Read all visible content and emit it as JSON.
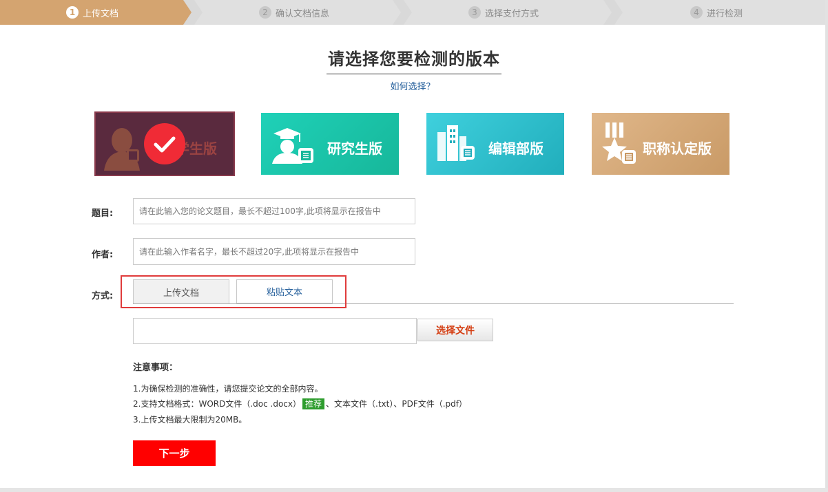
{
  "stepper": {
    "steps": [
      {
        "num": "1",
        "label": "上传文档"
      },
      {
        "num": "2",
        "label": "确认文档信息"
      },
      {
        "num": "3",
        "label": "选择支付方式"
      },
      {
        "num": "4",
        "label": "进行检测"
      }
    ],
    "active_color": "#d4a470",
    "inactive_color": "#e0e0e0"
  },
  "main": {
    "title": "请选择您要检测的版本",
    "help_link": "如何选择？"
  },
  "versions": [
    {
      "label": "学生版",
      "icon": "student-icon",
      "color": "#5a2a3e",
      "selected": true
    },
    {
      "label": "研究生版",
      "icon": "graduate-cap-icon",
      "color": "#1ec3a8"
    },
    {
      "label": "编辑部版",
      "icon": "building-icon",
      "color": "#2bbfcc"
    },
    {
      "label": "职称认定版",
      "icon": "medal-star-icon",
      "color": "#d2a675"
    }
  ],
  "form": {
    "title_label": "题目:",
    "title_placeholder": "请在此输入您的论文题目，最长不超过100字,此项将显示在报告中",
    "author_label": "作者:",
    "author_placeholder": "请在此输入作者名字，最长不超过20字,此项将显示在报告中",
    "method_label": "方式:",
    "tabs": [
      "上传文档",
      "粘贴文本"
    ],
    "file_button": "选择文件"
  },
  "notes": {
    "title": "注意事项：",
    "line1": "1.为确保检测的准确性，请您提交论文的全部内容。",
    "line2_before": "2.支持文档格式：WORD文件（.doc .docx）",
    "badge": "推荐",
    "line2_after": "、文本文件（.txt）、PDF文件（.pdf）",
    "line3": "3.上传文档最大限制为20MB。"
  },
  "actions": {
    "next": "下一步"
  },
  "colors": {
    "accent_red": "#ff0000",
    "link_blue": "#1f5b99",
    "badge_green": "#2e9d2e"
  }
}
